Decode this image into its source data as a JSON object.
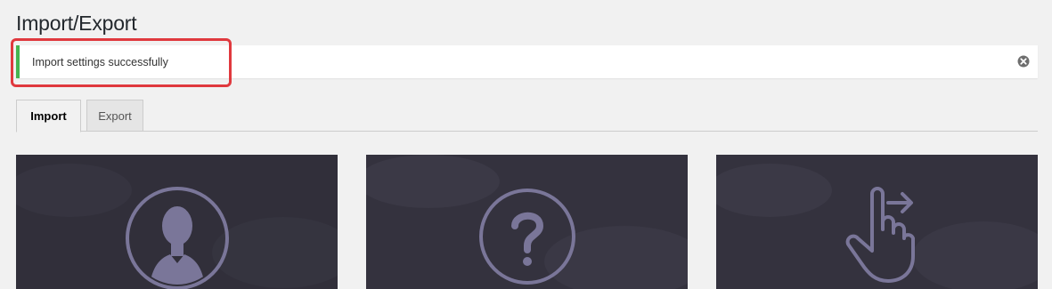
{
  "page": {
    "title": "Import/Export"
  },
  "notice": {
    "message": "Import settings successfully",
    "status_color": "#46b450",
    "dismiss_icon": "close-circle-icon"
  },
  "tabs": [
    {
      "label": "Import",
      "active": true
    },
    {
      "label": "Export",
      "active": false
    }
  ],
  "cards": [
    {
      "icon": "user-silhouette-icon"
    },
    {
      "icon": "question-mark-icon"
    },
    {
      "icon": "hand-pointer-icon"
    }
  ],
  "colors": {
    "card_background": "#34323e",
    "icon_color": "#7a7699",
    "highlight": "#e0393e"
  }
}
